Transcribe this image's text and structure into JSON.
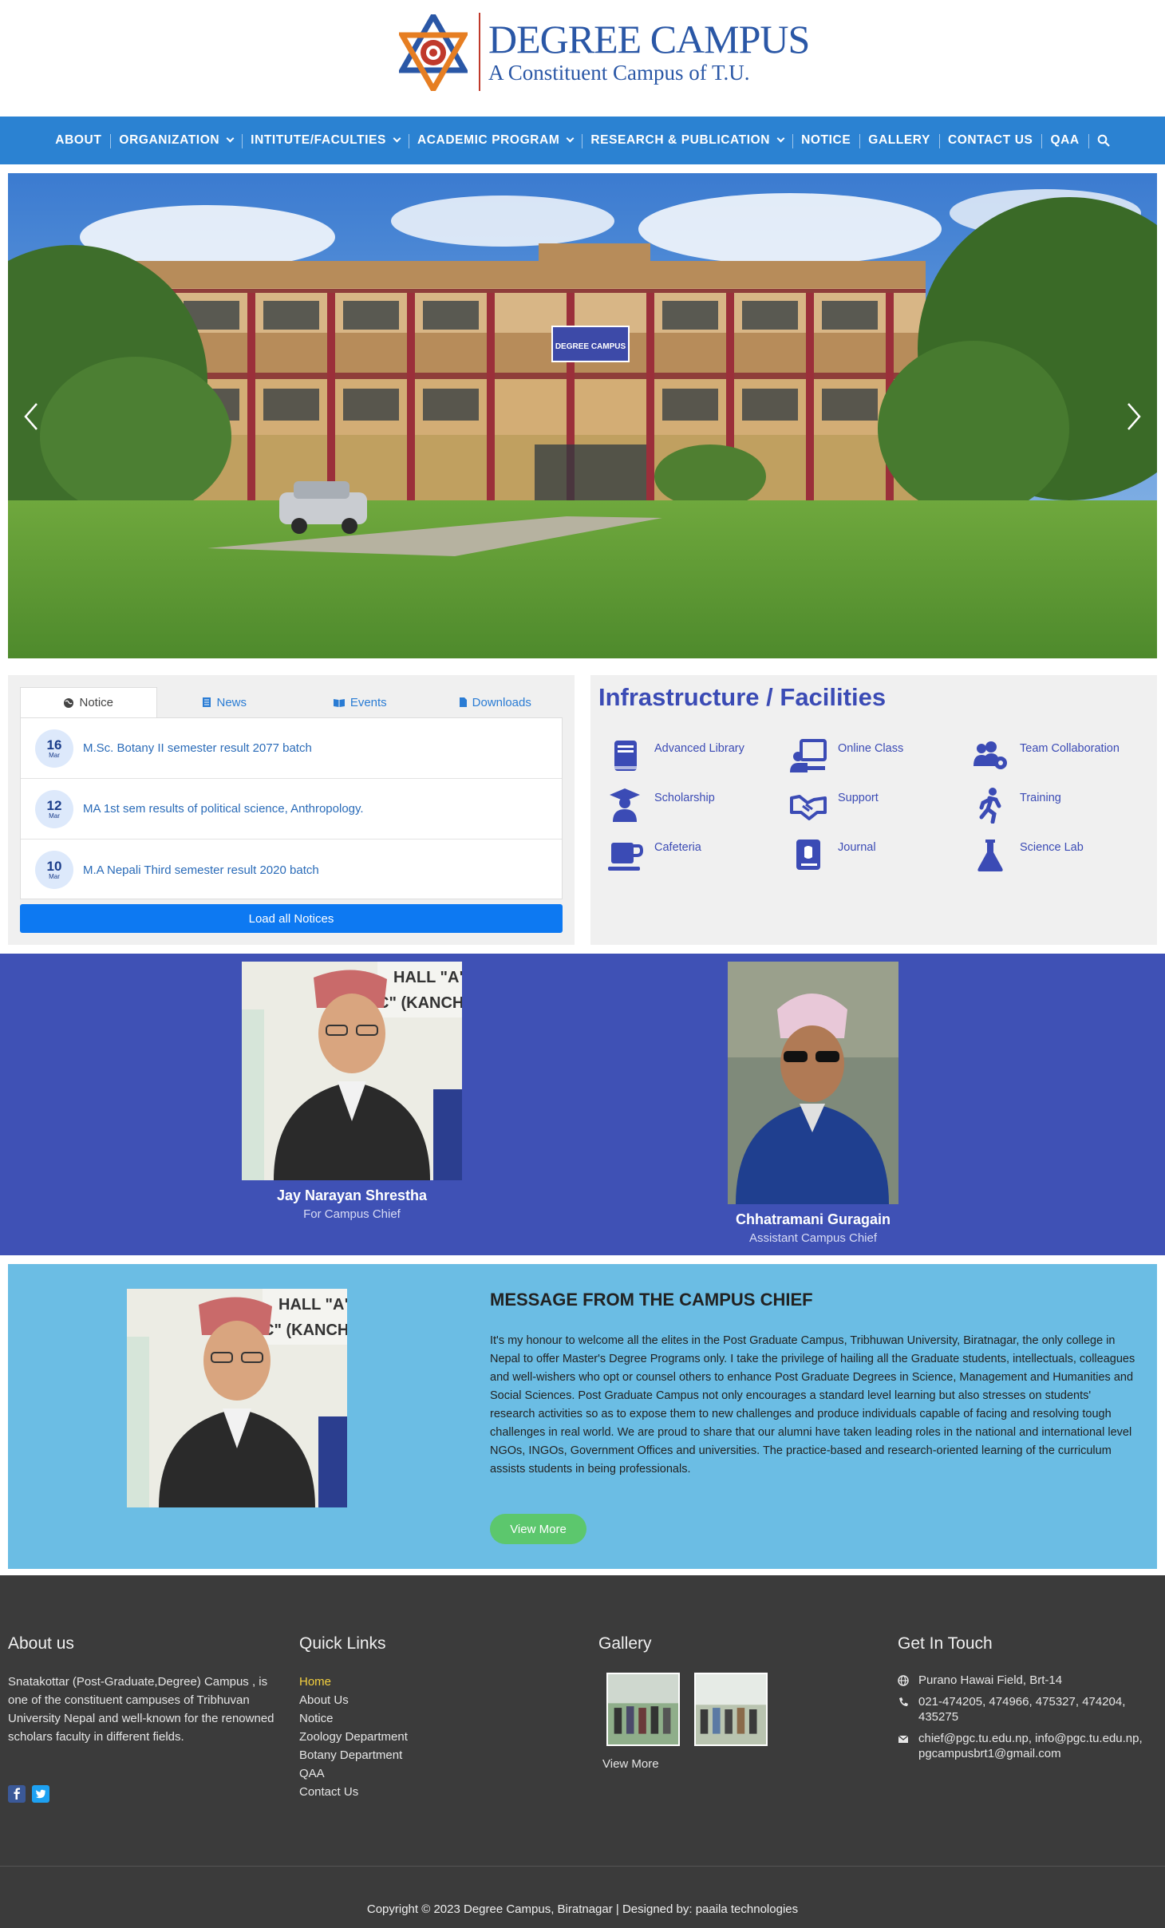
{
  "header": {
    "logo_title": "DEGREE CAMPUS",
    "logo_subtitle": "A Constituent Campus of T.U."
  },
  "nav": {
    "items": [
      {
        "label": "ABOUT",
        "dropdown": false
      },
      {
        "label": "ORGANIZATION",
        "dropdown": true
      },
      {
        "label": "INTITUTE/FACULTIES",
        "dropdown": true
      },
      {
        "label": "ACADEMIC PROGRAM",
        "dropdown": true
      },
      {
        "label": "RESEARCH & PUBLICATION",
        "dropdown": true
      },
      {
        "label": "NOTICE",
        "dropdown": false
      },
      {
        "label": "GALLERY",
        "dropdown": false
      },
      {
        "label": "CONTACT US",
        "dropdown": false
      },
      {
        "label": "QAA",
        "dropdown": false
      }
    ],
    "search_icon": "search-icon"
  },
  "slider": {
    "banner_line1": "DEGREE CAMPUS"
  },
  "notice_panel": {
    "tabs": [
      {
        "label": "Notice",
        "icon": "globe-icon",
        "active": true
      },
      {
        "label": "News",
        "icon": "newspaper-icon",
        "active": false
      },
      {
        "label": "Events",
        "icon": "book-open-icon",
        "active": false
      },
      {
        "label": "Downloads",
        "icon": "file-icon",
        "active": false
      }
    ],
    "notices": [
      {
        "day": "16",
        "month": "Mar",
        "title": "M.Sc. Botany II semester result 2077 batch"
      },
      {
        "day": "12",
        "month": "Mar",
        "title": "MA 1st sem results of political science, Anthropology."
      },
      {
        "day": "10",
        "month": "Mar",
        "title": "M.A Nepali Third semester result 2020 batch"
      }
    ],
    "load_all": "Load all Notices"
  },
  "infrastructure": {
    "title": "Infrastructure / Facilities",
    "items": [
      {
        "label": "Advanced Library",
        "icon": "book-icon"
      },
      {
        "label": "Online Class",
        "icon": "online-class-icon"
      },
      {
        "label": "Team Collaboration",
        "icon": "team-collaboration-icon"
      },
      {
        "label": "Scholarship",
        "icon": "graduate-icon"
      },
      {
        "label": "Support",
        "icon": "handshake-icon"
      },
      {
        "label": "Training",
        "icon": "running-icon"
      },
      {
        "label": "Cafeteria",
        "icon": "coffee-cup-icon"
      },
      {
        "label": "Journal",
        "icon": "journal-icon"
      },
      {
        "label": "Science Lab",
        "icon": "flask-icon"
      }
    ]
  },
  "leaders": [
    {
      "name": "Jay Narayan Shrestha",
      "role": "For Campus Chief"
    },
    {
      "name": "Chhatramani Guragain",
      "role": "Assistant Campus Chief"
    }
  ],
  "message": {
    "title": "MESSAGE FROM THE CAMPUS CHIEF",
    "body": "It's my honour to welcome all the elites in the Post Graduate Campus, Tribhuwan University, Biratnagar, the only college in Nepal to offer Master's Degree Programs only. I take the privilege of hailing all the Graduate students, intellectuals, colleagues and well-wishers who opt or counsel others to enhance Post Graduate Degrees in Science, Management and Humanities and Social Sciences. Post Graduate Campus not only encourages a standard level learning but also stresses on students' research activities so as to expose them to new challenges and produce individuals capable of facing and resolving tough challenges in real world. We are proud to share that our alumni have taken leading roles in the national and international level NGOs, INGOs, Government Offices and universities. The practice-based and research-oriented learning of the curriculum assists students in being professionals.",
    "button": "View More"
  },
  "footer": {
    "about": {
      "heading": "About us",
      "text": "Snatakottar (Post-Graduate,Degree) Campus , is one of the constituent campuses of Tribhuvan University Nepal and well-known for the renowned scholars faculty in different fields."
    },
    "quick_links": {
      "heading": "Quick Links",
      "links": [
        {
          "label": "Home",
          "active": true
        },
        {
          "label": "About Us",
          "active": false
        },
        {
          "label": "Notice",
          "active": false
        },
        {
          "label": "Zoology Department",
          "active": false
        },
        {
          "label": "Botany Department",
          "active": false
        },
        {
          "label": "QAA",
          "active": false
        },
        {
          "label": "Contact Us",
          "active": false
        }
      ]
    },
    "gallery": {
      "heading": "Gallery",
      "view_more": "View More"
    },
    "contact": {
      "heading": "Get In Touch",
      "address": "Purano Hawai Field, Brt-14",
      "phone": "021-474205, 474966, 475327, 474204, 435275",
      "email": "chief@pgc.tu.edu.np, info@pgc.tu.edu.np, pgcampusbrt1@gmail.com"
    },
    "copyright": "Copyright © 2023 Degree Campus, Biratnagar | Designed by: paaila technologies"
  },
  "colors": {
    "nav": "#2b82d2",
    "accent": "#3f51b5",
    "message_bg": "#6bbde4",
    "footer_bg": "#3b3b3b",
    "button_blue": "#0d79f2",
    "button_green": "#5cc76d"
  }
}
